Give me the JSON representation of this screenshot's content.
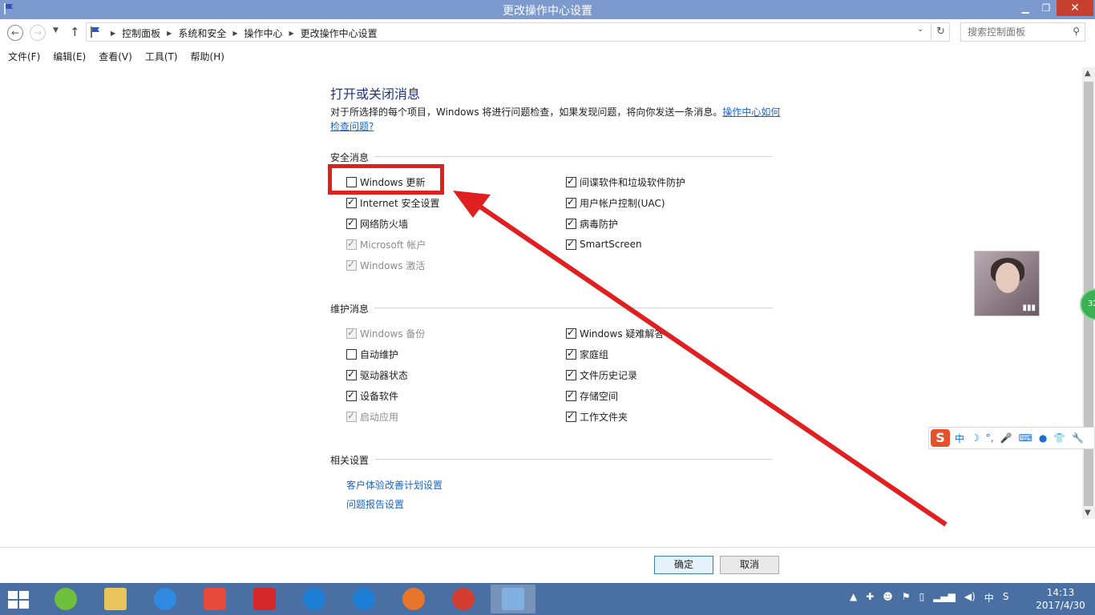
{
  "window": {
    "title": "更改操作中心设置",
    "minimize_glyph": "▁",
    "maximize_glyph": "❐",
    "close_glyph": "✕"
  },
  "nav": {
    "back_glyph": "←",
    "forward_glyph": "→",
    "dropdown_glyph": "▼",
    "up_glyph": "↑",
    "refresh_glyph": "↻"
  },
  "breadcrumbs": [
    "控制面板",
    "系统和安全",
    "操作中心",
    "更改操作中心设置"
  ],
  "search": {
    "placeholder": "搜索控制面板",
    "icon": "search-icon"
  },
  "menu": [
    "文件(F)",
    "编辑(E)",
    "查看(V)",
    "工具(T)",
    "帮助(H)"
  ],
  "main": {
    "heading": "打开或关闭消息",
    "description": "对于所选择的每个项目，Windows 将进行问题检查，如果发现问题，将向你发送一条消息。",
    "description_link": "操作中心如何检查问题?",
    "security": {
      "title": "安全消息",
      "left": [
        {
          "label": "Windows 更新",
          "checked": false,
          "enabled": true
        },
        {
          "label": "Internet 安全设置",
          "checked": true,
          "enabled": true
        },
        {
          "label": "网络防火墙",
          "checked": true,
          "enabled": true
        },
        {
          "label": "Microsoft 帐户",
          "checked": true,
          "enabled": false
        },
        {
          "label": "Windows 激活",
          "checked": true,
          "enabled": false
        }
      ],
      "right": [
        {
          "label": "间谍软件和垃圾软件防护",
          "checked": true,
          "enabled": true
        },
        {
          "label": "用户帐户控制(UAC)",
          "checked": true,
          "enabled": true
        },
        {
          "label": "病毒防护",
          "checked": true,
          "enabled": true
        },
        {
          "label": "SmartScreen",
          "checked": true,
          "enabled": true
        }
      ]
    },
    "maintenance": {
      "title": "维护消息",
      "left": [
        {
          "label": "Windows 备份",
          "checked": true,
          "enabled": false
        },
        {
          "label": "自动维护",
          "checked": false,
          "enabled": true
        },
        {
          "label": "驱动器状态",
          "checked": true,
          "enabled": true
        },
        {
          "label": "设备软件",
          "checked": true,
          "enabled": true
        },
        {
          "label": "启动应用",
          "checked": true,
          "enabled": false
        }
      ],
      "right": [
        {
          "label": "Windows 疑难解答",
          "checked": true,
          "enabled": true
        },
        {
          "label": "家庭组",
          "checked": true,
          "enabled": true
        },
        {
          "label": "文件历史记录",
          "checked": true,
          "enabled": true
        },
        {
          "label": "存储空间",
          "checked": true,
          "enabled": true
        },
        {
          "label": "工作文件夹",
          "checked": true,
          "enabled": true
        }
      ]
    },
    "related": {
      "title": "相关设置",
      "links": [
        "客户体验改善计划设置",
        "问题报告设置"
      ]
    }
  },
  "buttons": {
    "ok": "确定",
    "cancel": "取消"
  },
  "widgets": {
    "ball_text": "32",
    "ime_logo": "S",
    "ime_mode": "中"
  },
  "tray": {
    "ime": "中",
    "time": "14:13",
    "date": "2017/4/30"
  },
  "colors": {
    "titlebar": "#7c9acd",
    "link": "#1e64c8",
    "highlight": "#e02020",
    "taskbar": "#4a6fa3"
  }
}
